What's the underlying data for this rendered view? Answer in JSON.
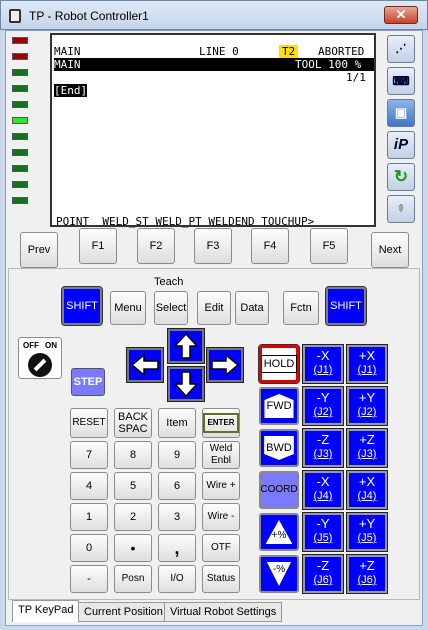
{
  "window": {
    "title": "TP - Robot Controller1",
    "close": "✕"
  },
  "leds": [
    "#a00000",
    "#a00000",
    "#0a7a0a",
    "#0a7a0a",
    "#0a7a0a",
    "#22ee22",
    "#0a7a0a",
    "#0a7a0a",
    "#0a7a0a",
    "#0a7a0a",
    "#0a7a0a"
  ],
  "screen": {
    "line1": {
      "prog": "MAIN",
      "line": "LINE 0",
      "mode": "T2",
      "status": "ABORTED"
    },
    "line2": {
      "prog": "MAIN",
      "tool": "TOOL 100 %"
    },
    "line3": {
      "page": "1/1"
    },
    "line4": {
      "end": "[End]"
    },
    "fkeys": "POINT  WELD_ST WELD_PT WELDEND TOUCHUP>"
  },
  "side_buttons": [
    "grid-icon",
    "keyboard-icon",
    "pendant-icon",
    "iP",
    "refresh-icon",
    "collapse-icon"
  ],
  "func_row": [
    "Prev",
    "F1",
    "F2",
    "F3",
    "F4",
    "F5",
    "Next"
  ],
  "teach_label": "Teach",
  "teach_row": [
    "SHIFT",
    "Menu",
    "Select",
    "Edit",
    "Data",
    "Fctn",
    "SHIFT"
  ],
  "onoff": {
    "off": "OFF",
    "on": "ON"
  },
  "step": "STEP",
  "keys": {
    "reset": "RESET",
    "backspace_1": "BACK",
    "backspace_2": "SPAC",
    "item": "Item",
    "enter": "ENTER",
    "k7": "7",
    "k8": "8",
    "k9": "9",
    "weld_1": "Weld",
    "weld_2": "Enbl",
    "k4": "4",
    "k5": "5",
    "k6": "6",
    "wireplus": "Wire +",
    "k1": "1",
    "k2": "2",
    "k3": "3",
    "wireminus": "Wire -",
    "k0": "0",
    "dot": "•",
    "comma": ",",
    "otf": "OTF",
    "minus": "-",
    "posn": "Posn",
    "io": "I/O",
    "status": "Status"
  },
  "motion": {
    "hold": "HOLD",
    "fwd": "FWD",
    "bwd": "BWD",
    "coord": "COORD",
    "speed_up": "+%",
    "speed_down": "-%"
  },
  "jog": [
    {
      "neg": "-X",
      "neg_j": "(J1)",
      "pos": "+X",
      "pos_j": "(J1)"
    },
    {
      "neg": "-Y",
      "neg_j": "(J2)",
      "pos": "+Y",
      "pos_j": "(J2)"
    },
    {
      "neg": "-Z",
      "neg_j": "(J3)",
      "pos": "+Z",
      "pos_j": "(J3)"
    },
    {
      "neg": "-X",
      "neg_j": "(J4)",
      "pos": "+X",
      "pos_j": "(J4)"
    },
    {
      "neg": "-Y",
      "neg_j": "(J5)",
      "pos": "+Y",
      "pos_j": "(J5)"
    },
    {
      "neg": "-Z",
      "neg_j": "(J6)",
      "pos": "+Z",
      "pos_j": "(J6)"
    }
  ],
  "tabs": [
    "TP KeyPad",
    "Current Position",
    "Virtual Robot Settings"
  ]
}
